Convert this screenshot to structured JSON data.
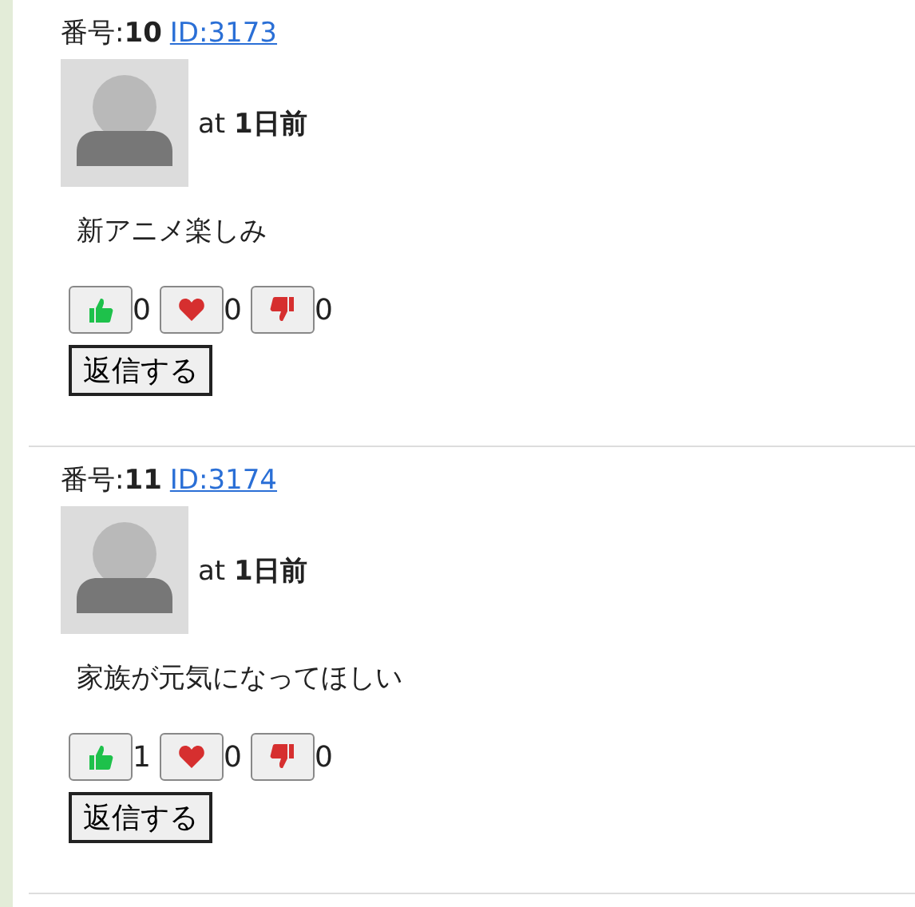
{
  "posts": [
    {
      "number": "番号:**10**",
      "id_link": "ID:3173",
      "time": "at **1日前**",
      "body": "新アニメ楽しみ",
      "reactions": [
        {
          "kind": "like",
          "count": "0"
        },
        {
          "kind": "love",
          "count": "0"
        },
        {
          "kind": "dislike",
          "count": "0"
        }
      ],
      "reply_button": "返信する"
    },
    {
      "number": "番号:**11**",
      "id_link": "ID:3174",
      "time": "at **1日前**",
      "body": "家族が元気になってほしい",
      "reactions": [
        {
          "kind": "like",
          "count": "1"
        },
        {
          "kind": "love",
          "count": "0"
        },
        {
          "kind": "dislike",
          "count": "0"
        }
      ],
      "reply_button": "返信する"
    }
  ]
}
